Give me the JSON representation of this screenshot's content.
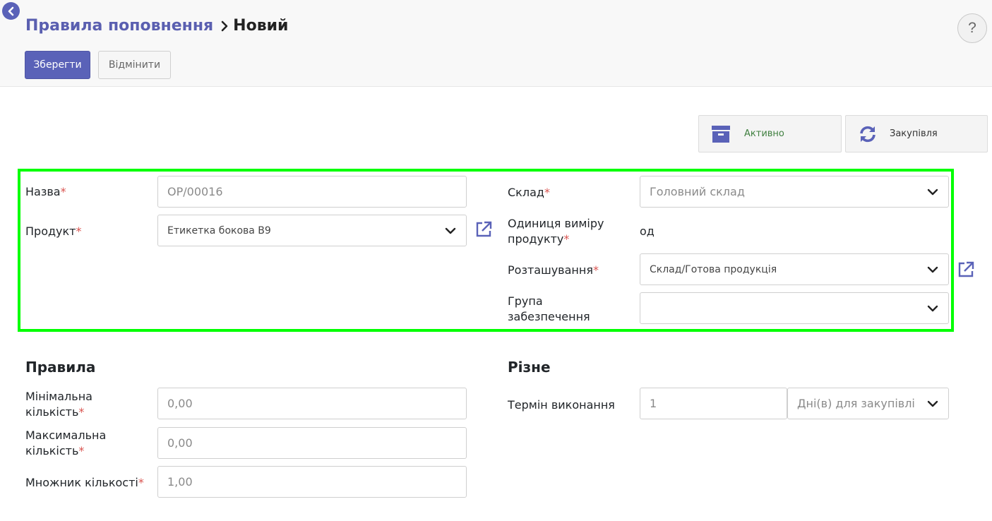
{
  "breadcrumb": {
    "parent": "Правила поповнення",
    "current": "Новий"
  },
  "help_label": "?",
  "buttons": {
    "save": "Зберегти",
    "discard": "Відмінити"
  },
  "smart_buttons": {
    "active": "Активно",
    "procurement": "Закупівля"
  },
  "form": {
    "name_label": "Назва",
    "name_placeholder": "OP/00016",
    "product_label": "Продукт",
    "product_value": "Етикетка бокова B9",
    "warehouse_label": "Склад",
    "warehouse_value": "Головний склад",
    "uom_label_1": "Одиниця виміру",
    "uom_label_2": "продукту",
    "uom_value": "од",
    "location_label": "Розташування",
    "location_value": "Склад/Готова продукція",
    "group_label_1": "Група",
    "group_label_2": "забезпечення",
    "group_value": ""
  },
  "rules": {
    "title": "Правила",
    "min_label_1": "Мінімальна",
    "min_label_2": "кількість",
    "min_value": "0,00",
    "max_label_1": "Максимальна",
    "max_label_2": "кількість",
    "max_value": "0,00",
    "multiple_label": "Множник кількості",
    "multiple_value": "1,00"
  },
  "misc": {
    "title": "Різне",
    "lead_label": "Термін виконання",
    "lead_value": "1",
    "lead_unit": "Дні(в) для закупівлі"
  },
  "required_mark": "*",
  "colors": {
    "primary": "#5a62b8",
    "highlight": "#00ff00",
    "required": "#d9534f",
    "active_text": "#3f7f3f"
  }
}
